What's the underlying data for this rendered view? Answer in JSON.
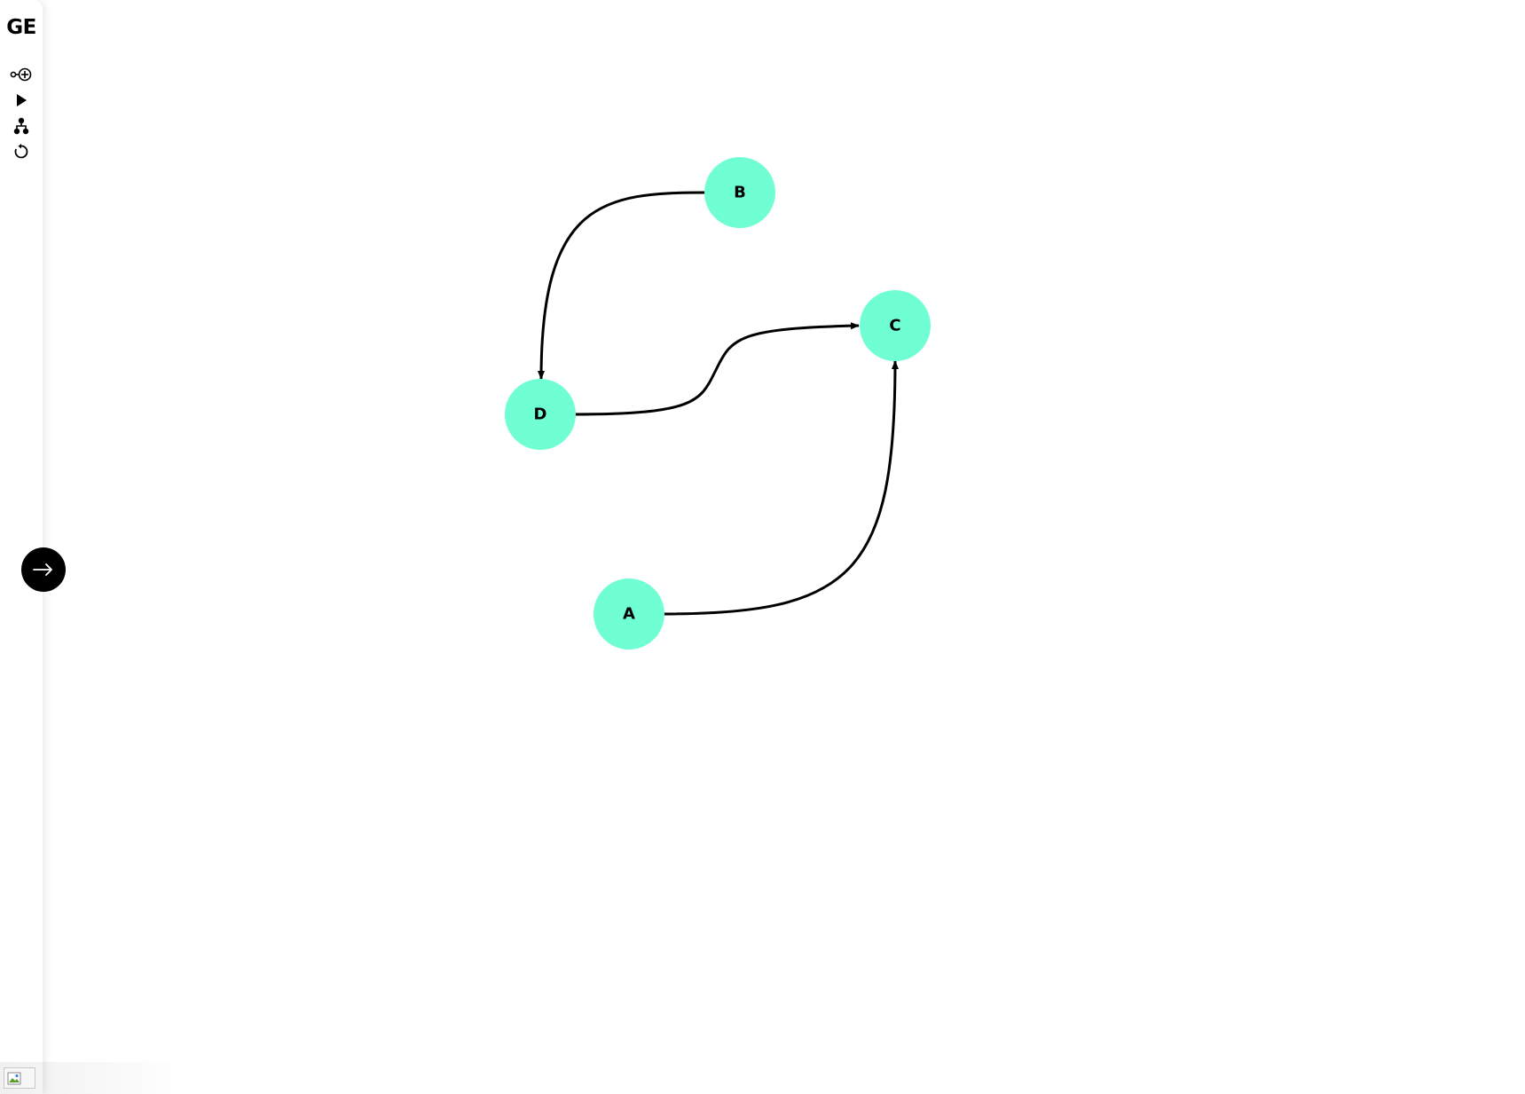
{
  "app": {
    "logo": "GE"
  },
  "toolbar": {
    "tools": [
      {
        "id": "add-node",
        "icon": "add-node-icon"
      },
      {
        "id": "run",
        "icon": "play-icon"
      },
      {
        "id": "layout",
        "icon": "tree-hierarchy-icon"
      },
      {
        "id": "reset",
        "icon": "refresh-icon"
      }
    ]
  },
  "toggle": {
    "icon": "arrow-right-icon"
  },
  "graph": {
    "node_color": "#70ffd2",
    "edge_color": "#000000",
    "nodes": [
      {
        "id": "B",
        "label": "B"
      },
      {
        "id": "C",
        "label": "C"
      },
      {
        "id": "D",
        "label": "D"
      },
      {
        "id": "A",
        "label": "A"
      }
    ],
    "edges": [
      {
        "from": "B",
        "to": "D"
      },
      {
        "from": "D",
        "to": "C"
      },
      {
        "from": "A",
        "to": "C"
      }
    ]
  }
}
